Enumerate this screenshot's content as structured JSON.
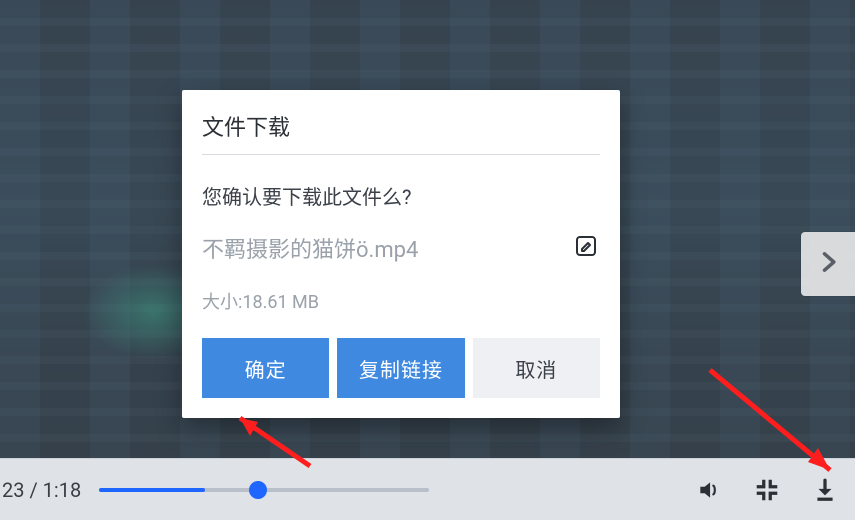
{
  "player": {
    "time_display": "23 / 1:18",
    "progress": {
      "percent": 32,
      "thumb_percent": 48
    },
    "icons": {
      "volume": "volume-icon",
      "exit_fullscreen": "exit-fullscreen-icon",
      "download": "download-icon",
      "next": "chevron-right-icon"
    }
  },
  "dialog": {
    "title": "文件下载",
    "confirm_text": "您确认要下载此文件么?",
    "file_name": "不羁摄影的猫饼ö.mp4",
    "size_label": "大小:18.61 MB",
    "buttons": {
      "ok": "确定",
      "copy_link": "复制链接",
      "cancel": "取消"
    }
  },
  "colors": {
    "accent": "#3f8ae0",
    "progress": "#1f66ff",
    "annotation": "#ff1e1e"
  }
}
